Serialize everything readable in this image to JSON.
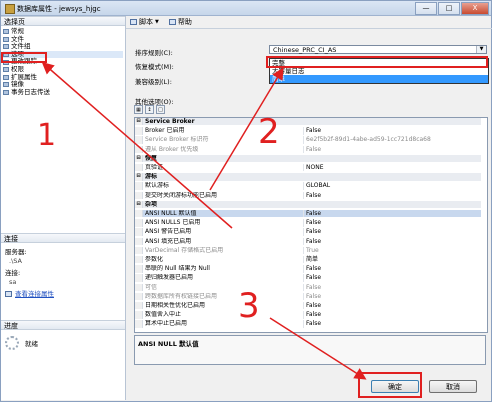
{
  "window": {
    "title": "数据库属性 - jewsys_hjgc",
    "controls": [
      "—",
      "□",
      "X"
    ]
  },
  "left": {
    "pages_header": "选择页",
    "pages": [
      {
        "label": "常规",
        "icon": "page-icon"
      },
      {
        "label": "文件",
        "icon": "page-icon"
      },
      {
        "label": "文件组",
        "icon": "page-icon"
      },
      {
        "label": "选项",
        "icon": "page-icon"
      },
      {
        "label": "更改跟踪",
        "icon": "page-icon"
      },
      {
        "label": "权限",
        "icon": "page-icon"
      },
      {
        "label": "扩展属性",
        "icon": "page-icon"
      },
      {
        "label": "镜像",
        "icon": "page-icon"
      },
      {
        "label": "事务日志传送",
        "icon": "page-icon"
      }
    ],
    "selected_page": "选项",
    "connection_header": "连接",
    "server_label": "服务器:",
    "server_value": ".\\SA",
    "connect_label": "连接:",
    "connect_value": "sa",
    "view_conn_link": "查看连接属性",
    "progress_header": "进度",
    "progress_status": "就绪"
  },
  "toolbar": {
    "script_label": "脚本",
    "help_label": "帮助"
  },
  "form": {
    "collation_label": "排序规则(C):",
    "collation_value": "Chinese_PRC_CI_AS",
    "recovery_label": "恢复模式(M):",
    "recovery_value": "简单",
    "compat_label": "兼容级别(L):",
    "recovery_options": [
      "完整",
      "大容量日志",
      "简单"
    ],
    "recovery_highlighted": "简单",
    "other_label": "其他选项(O):"
  },
  "grid": {
    "rows": [
      {
        "type": "category",
        "name": "Service Broker",
        "value": ""
      },
      {
        "type": "prop",
        "name": "Broker 已启用",
        "value": "False"
      },
      {
        "type": "disabled",
        "name": "Service Broker 标识符",
        "value": "6e2f5b2f-89d1-4abe-ad59-1cc721d8ca68"
      },
      {
        "type": "disabled",
        "name": "遵从 Broker 优先级",
        "value": "False"
      },
      {
        "type": "category",
        "name": "恢复",
        "value": ""
      },
      {
        "type": "prop",
        "name": "页验证",
        "value": "NONE"
      },
      {
        "type": "category",
        "name": "游标",
        "value": ""
      },
      {
        "type": "prop",
        "name": "默认游标",
        "value": "GLOBAL"
      },
      {
        "type": "prop",
        "name": "提交时关闭游标功能已启用",
        "value": "False"
      },
      {
        "type": "category",
        "name": "杂项",
        "value": ""
      },
      {
        "type": "selected",
        "name": "ANSI NULL 默认值",
        "value": "False"
      },
      {
        "type": "prop",
        "name": "ANSI NULLS 已启用",
        "value": "False"
      },
      {
        "type": "prop",
        "name": "ANSI 警告已启用",
        "value": "False"
      },
      {
        "type": "prop",
        "name": "ANSI 填充已启用",
        "value": "False"
      },
      {
        "type": "disabled",
        "name": "VarDecimal 存储格式已启用",
        "value": "True"
      },
      {
        "type": "prop",
        "name": "参数化",
        "value": "简单"
      },
      {
        "type": "prop",
        "name": "串联的 Null 结果为 Null",
        "value": "False"
      },
      {
        "type": "prop",
        "name": "递归触发器已启用",
        "value": "False"
      },
      {
        "type": "disabled",
        "name": "可信",
        "value": "False"
      },
      {
        "type": "disabled",
        "name": "跨数据库所有权链接已启用",
        "value": "False"
      },
      {
        "type": "prop",
        "name": "日期相关性优化已启用",
        "value": "False"
      },
      {
        "type": "prop",
        "name": "数值舍入中止",
        "value": "False"
      },
      {
        "type": "prop",
        "name": "算术中止已启用",
        "value": "False"
      }
    ]
  },
  "description": "ANSI NULL 默认值",
  "buttons": {
    "ok": "确定",
    "cancel": "取消"
  },
  "annotations": {
    "color": "#e02020",
    "numbers": [
      "1",
      "2",
      "3"
    ]
  }
}
